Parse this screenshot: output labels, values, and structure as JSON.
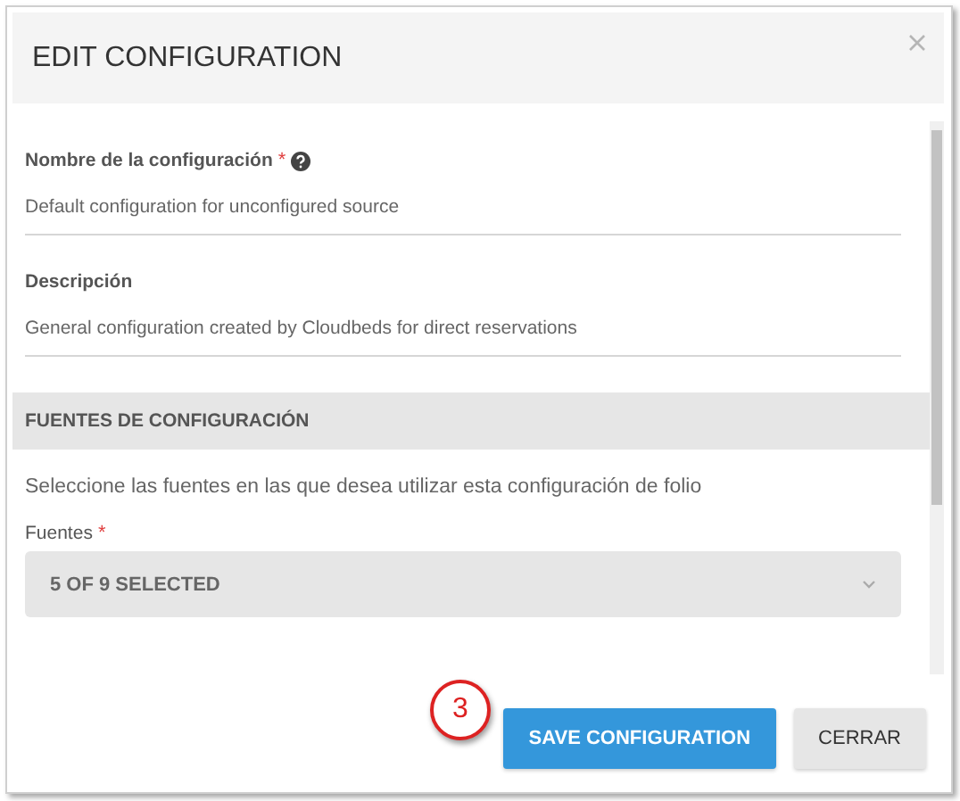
{
  "dialog": {
    "title": "EDIT CONFIGURATION"
  },
  "fields": [
    {
      "label": "Nombre de la configuración",
      "required_marker": "*",
      "help": true,
      "value": "Default configuration for unconfigured source"
    },
    {
      "label": "Descripción",
      "help": false,
      "value": "General configuration created by Cloudbeds for direct reservations"
    }
  ],
  "section": {
    "title": "FUENTES DE CONFIGURACIÓN",
    "description": "Seleccione las fuentes en las que desea utilizar esta configuración de folio",
    "select": {
      "label": "Fuentes",
      "required_marker": "*",
      "value": "5 OF 9 SELECTED"
    }
  },
  "callout": {
    "text": "3"
  },
  "buttons": [
    {
      "label": "SAVE CONFIGURATION",
      "kind": "primary"
    },
    {
      "label": "CERRAR",
      "kind": "default"
    }
  ]
}
